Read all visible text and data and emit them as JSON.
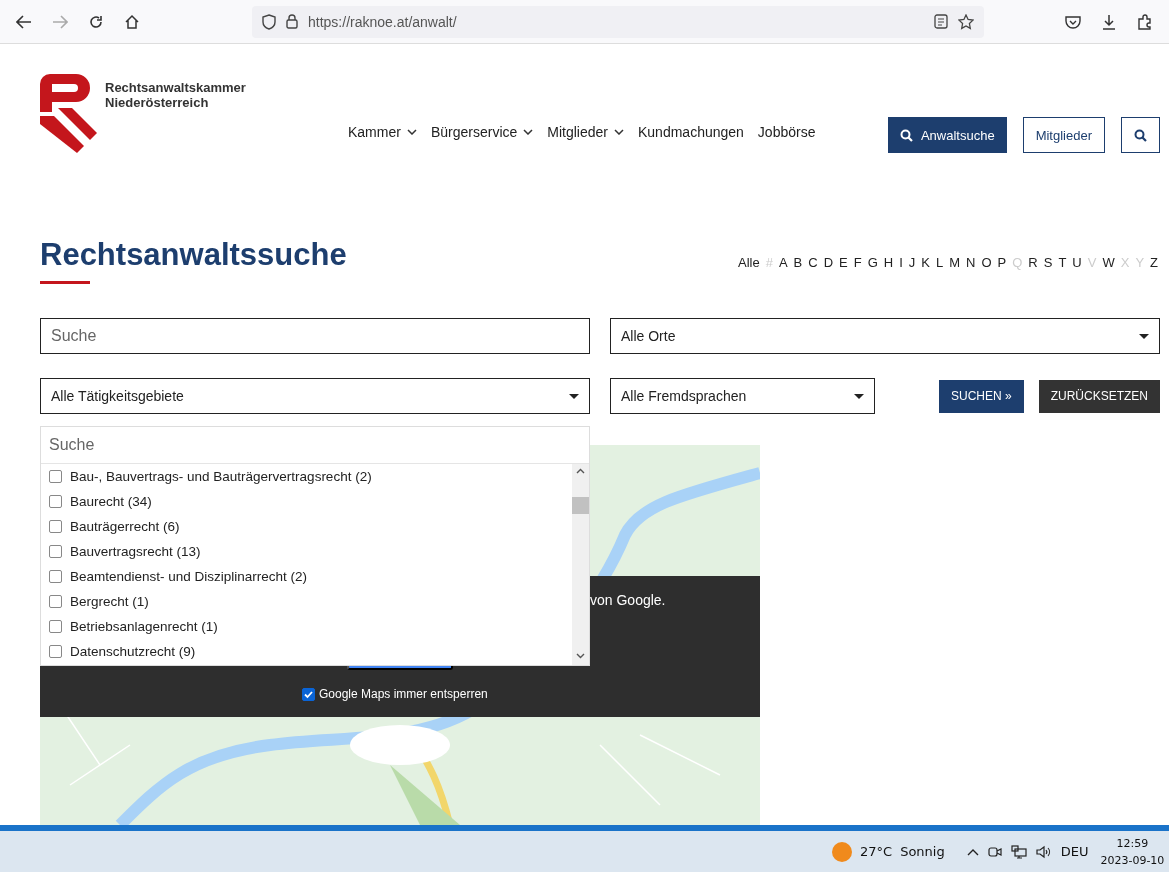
{
  "browser": {
    "url": "https://raknoe.at/anwalt/"
  },
  "header": {
    "org_line1": "Rechtsanwaltskammer",
    "org_line2": "Niederösterreich",
    "nav": [
      {
        "label": "Kammer",
        "dropdown": true
      },
      {
        "label": "Bürgerservice",
        "dropdown": true
      },
      {
        "label": "Mitglieder",
        "dropdown": true
      },
      {
        "label": "Kundmachungen",
        "dropdown": false
      },
      {
        "label": "Jobbörse",
        "dropdown": false
      }
    ],
    "search_button": "Anwaltsuche",
    "members_button": "Mitglieder"
  },
  "title": "Rechtsanwaltssuche",
  "alphabet": [
    {
      "label": "Alle",
      "disabled": false
    },
    {
      "label": "#",
      "disabled": true
    },
    {
      "label": "A",
      "disabled": false
    },
    {
      "label": "B",
      "disabled": false
    },
    {
      "label": "C",
      "disabled": false
    },
    {
      "label": "D",
      "disabled": false
    },
    {
      "label": "E",
      "disabled": false
    },
    {
      "label": "F",
      "disabled": false
    },
    {
      "label": "G",
      "disabled": false
    },
    {
      "label": "H",
      "disabled": false
    },
    {
      "label": "I",
      "disabled": false
    },
    {
      "label": "J",
      "disabled": false
    },
    {
      "label": "K",
      "disabled": false
    },
    {
      "label": "L",
      "disabled": false
    },
    {
      "label": "M",
      "disabled": false
    },
    {
      "label": "N",
      "disabled": false
    },
    {
      "label": "O",
      "disabled": false
    },
    {
      "label": "P",
      "disabled": false
    },
    {
      "label": "Q",
      "disabled": true
    },
    {
      "label": "R",
      "disabled": false
    },
    {
      "label": "S",
      "disabled": false
    },
    {
      "label": "T",
      "disabled": false
    },
    {
      "label": "U",
      "disabled": false
    },
    {
      "label": "V",
      "disabled": true
    },
    {
      "label": "W",
      "disabled": false
    },
    {
      "label": "X",
      "disabled": true
    },
    {
      "label": "Y",
      "disabled": true
    },
    {
      "label": "Z",
      "disabled": false
    }
  ],
  "filters": {
    "search": {
      "placeholder": "Suche"
    },
    "places": "Alle Orte",
    "areas": "Alle Tätigkeitsgebiete",
    "languages": "Alle Fremdsprachen",
    "submit": "SUCHEN »",
    "reset": "ZURÜCKSETZEN"
  },
  "areas_dropdown": {
    "search": {
      "placeholder": "Suche"
    },
    "options": [
      {
        "label": "Bau-, Bauvertrags- und Bauträgervertragsrecht (2)",
        "checked": false
      },
      {
        "label": "Baurecht (34)",
        "checked": false
      },
      {
        "label": "Bauträgerrecht (6)",
        "checked": false
      },
      {
        "label": "Bauvertragsrecht (13)",
        "checked": false
      },
      {
        "label": "Beamtendienst- und Disziplinarrecht (2)",
        "checked": false
      },
      {
        "label": "Bergrecht (1)",
        "checked": false
      },
      {
        "label": "Betriebsanlagenrecht (1)",
        "checked": false
      },
      {
        "label": "Datenschutzrecht (9)",
        "checked": false
      }
    ]
  },
  "map": {
    "notice": "von Google.",
    "always_unlock": {
      "label": "Google Maps immer entsperren",
      "checked": true
    }
  },
  "taskbar": {
    "temperature": "27°C",
    "weather": "Sonnig",
    "language": "DEU",
    "time": "12:59",
    "date": "2023-09-10"
  }
}
